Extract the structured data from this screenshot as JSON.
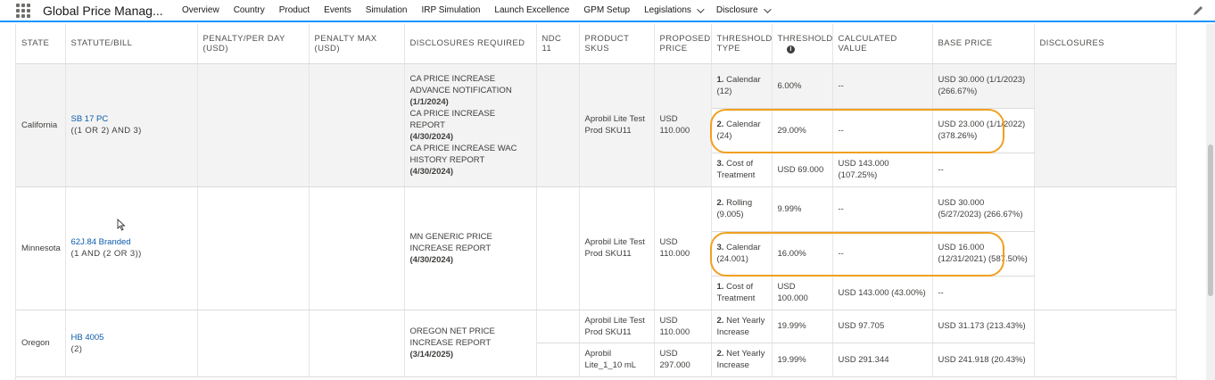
{
  "app": {
    "title": "Global Price Manag..."
  },
  "nav": {
    "items": [
      {
        "label": "Overview"
      },
      {
        "label": "Country"
      },
      {
        "label": "Product"
      },
      {
        "label": "Events"
      },
      {
        "label": "Simulation"
      },
      {
        "label": "IRP Simulation"
      },
      {
        "label": "Launch Excellence"
      },
      {
        "label": "GPM Setup"
      },
      {
        "label": "Legislations",
        "dropdown": true
      },
      {
        "label": "Disclosure",
        "dropdown": true
      }
    ]
  },
  "table": {
    "headers": {
      "state": "STATE",
      "statute": "STATUTE/BILL",
      "penalty_day": "PENALTY/PER DAY (USD)",
      "penalty_max": "PENALTY MAX (USD)",
      "disclosures_required": "DISCLOSURES REQUIRED",
      "ndc": "NDC 11",
      "product_skus": "PRODUCT SKUS",
      "proposed_price": "PROPOSED PRICE",
      "threshold_type": "THRESHOLD TYPE",
      "threshold": "THRESHOLD",
      "calculated_value": "CALCULATED VALUE",
      "base_price": "BASE PRICE",
      "disclosures": "DISCLOSURES"
    },
    "groups": [
      {
        "state": "California",
        "statute_link": "SB 17 PC",
        "statute_rule": "((1 OR 2) AND 3)",
        "disclosures_required": [
          {
            "text": "CA PRICE INCREASE ADVANCE NOTIFICATION",
            "date": "(1/1/2024)"
          },
          {
            "text": "CA PRICE INCREASE REPORT",
            "date": "(4/30/2024)"
          },
          {
            "text": "CA PRICE INCREASE WAC HISTORY REPORT",
            "date": "(4/30/2024)"
          }
        ],
        "product_sku": "Aprobil Lite Test Prod SKU11",
        "proposed_price": "USD 110.000",
        "rows": [
          {
            "num": "1.",
            "type": "Calendar (12)",
            "threshold": "6.00%",
            "calc": "--",
            "base": "USD 30.000 (1/1/2023) (266.67%)"
          },
          {
            "num": "2.",
            "type": "Calendar (24)",
            "threshold": "29.00%",
            "calc": "--",
            "base": "USD 23.000 (1/1/2022) (378.26%)"
          },
          {
            "num": "3.",
            "type": "Cost of Treatment",
            "threshold": "USD 69.000",
            "calc": "USD 143.000 (107.25%)",
            "base": "--"
          }
        ]
      },
      {
        "state": "Minnesota",
        "statute_link": "62J.84 Branded",
        "statute_rule": "(1 AND (2 OR 3))",
        "disclosures_required": [
          {
            "text": "MN GENERIC PRICE INCREASE REPORT",
            "date": "(4/30/2024)"
          }
        ],
        "product_sku": "Aprobil Lite Test Prod SKU11",
        "proposed_price": "USD 110.000",
        "rows": [
          {
            "num": "2.",
            "type": "Rolling (9.005)",
            "threshold": "9.99%",
            "calc": "--",
            "base": "USD 30.000 (5/27/2023) (266.67%)"
          },
          {
            "num": "3.",
            "type": "Calendar (24.001)",
            "threshold": "16.00%",
            "calc": "--",
            "base": "USD 16.000 (12/31/2021) (587.50%)"
          },
          {
            "num": "1.",
            "type": "Cost of Treatment",
            "threshold": "USD 100.000",
            "calc": "USD 143.000 (43.00%)",
            "base": "--"
          }
        ]
      },
      {
        "state": "Oregon",
        "statute_link": "HB 4005",
        "statute_rule": "(2)",
        "disclosures_required": [
          {
            "text": "OREGON NET PRICE INCREASE REPORT",
            "date": "(3/14/2025)"
          }
        ],
        "rows": [
          {
            "sku": "Aprobil Lite Test Prod SKU11",
            "proposed": "USD 110.000",
            "num": "2.",
            "type": "Net Yearly Increase",
            "threshold": "19.99%",
            "calc": "USD 97.705",
            "base": "USD 31.173 (213.43%)"
          },
          {
            "sku": "Aprobil Lite_1_10 mL",
            "proposed": "USD 297.000",
            "num": "2.",
            "type": "Net Yearly Increase",
            "threshold": "19.99%",
            "calc": "USD 291.344",
            "base": "USD 241.918 (20.43%)"
          }
        ]
      }
    ]
  },
  "colors": {
    "accent": "#1b96ff",
    "highlight": "#f0a020",
    "link": "#0b5cab",
    "group_shade": "#f3f3f3"
  }
}
